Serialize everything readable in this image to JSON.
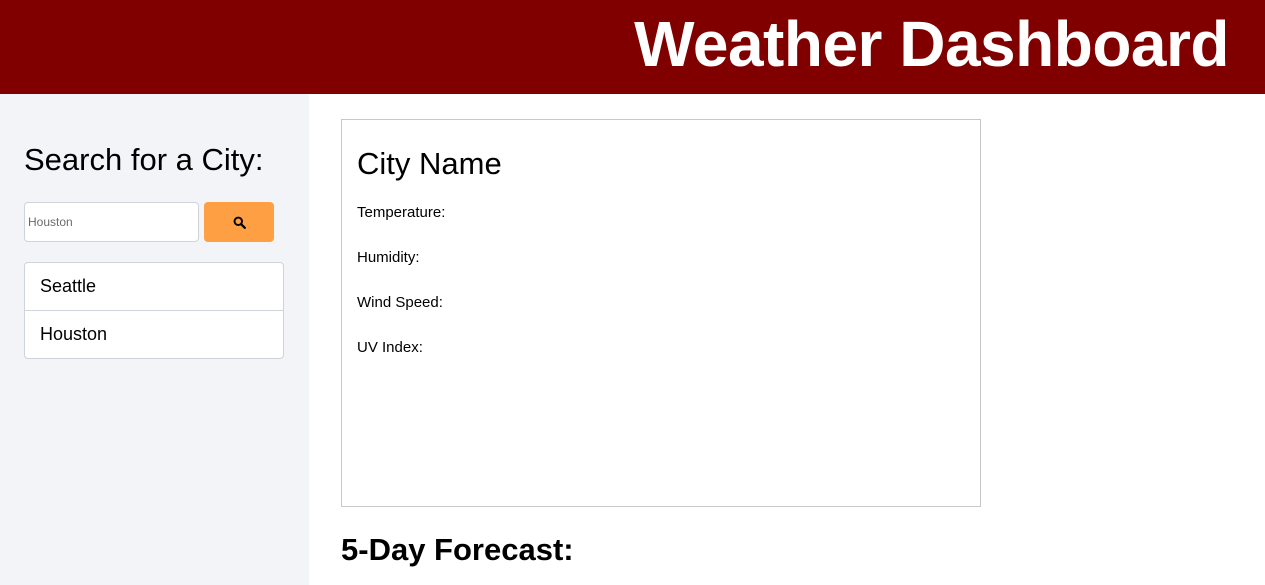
{
  "header": {
    "title": "Weather Dashboard"
  },
  "sidebar": {
    "heading": "Search for a City:",
    "search": {
      "value": "",
      "placeholder": "Houston",
      "button_icon": "search-icon"
    },
    "history": [
      {
        "label": "Seattle"
      },
      {
        "label": "Houston"
      }
    ]
  },
  "current": {
    "city_name": "City Name",
    "temperature_label": "Temperature:",
    "humidity_label": "Humidity:",
    "wind_speed_label": "Wind Speed:",
    "uv_index_label": "UV Index:"
  },
  "forecast": {
    "heading": "5-Day Forecast:"
  },
  "colors": {
    "header_bg": "#800000",
    "sidebar_bg": "#f3f4f8",
    "accent": "#ff9f43"
  }
}
